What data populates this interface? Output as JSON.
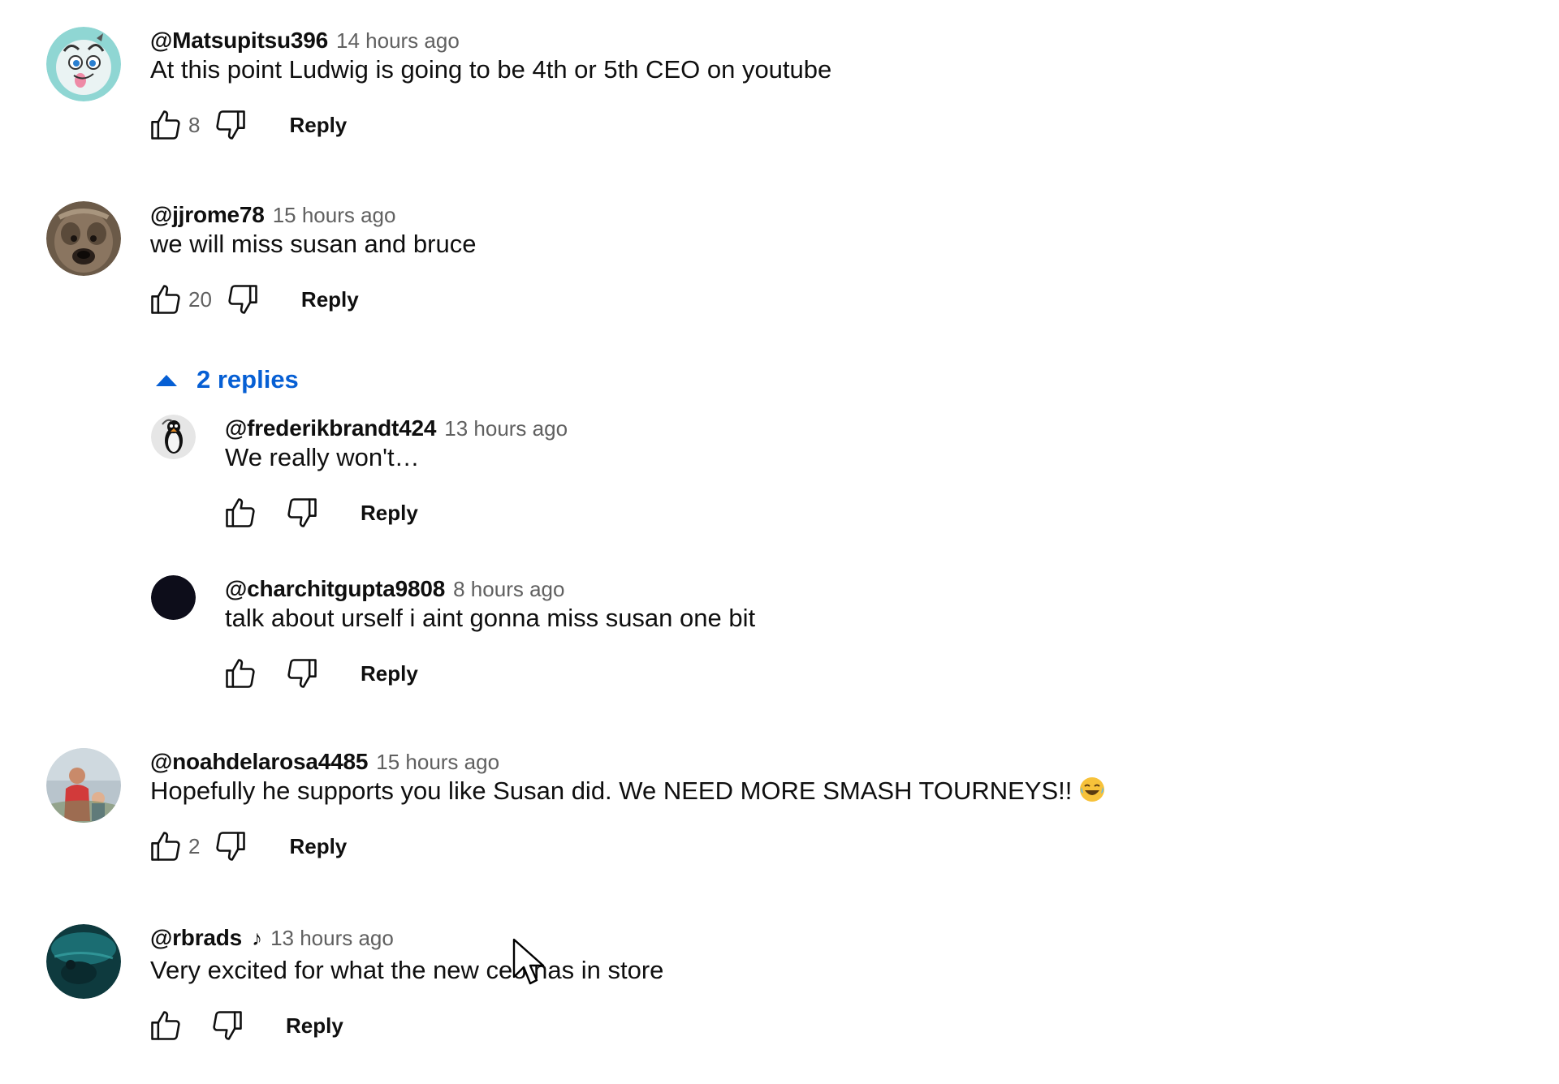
{
  "comments": [
    {
      "author": "@Matsupitsu396",
      "timestamp": "14 hours ago",
      "text": "At this point Ludwig is going to be 4th or 5th CEO on youtube",
      "likes": "8",
      "reply_label": "Reply"
    },
    {
      "author": "@jjrome78",
      "timestamp": "15 hours ago",
      "text": "we will miss susan and bruce",
      "likes": "20",
      "reply_label": "Reply",
      "replies_toggle": "2 replies",
      "replies": [
        {
          "author": "@frederikbrandt424",
          "timestamp": "13 hours ago",
          "text": "We really won't…",
          "likes": "",
          "reply_label": "Reply"
        },
        {
          "author": "@charchitgupta9808",
          "timestamp": "8 hours ago",
          "text": "talk about urself i aint gonna miss susan one bit",
          "likes": "",
          "reply_label": "Reply"
        }
      ]
    },
    {
      "author": "@noahdelarosa4485",
      "timestamp": "15 hours ago",
      "text": "Hopefully he supports you like Susan did. We NEED MORE SMASH TOURNEYS!!",
      "emoji": "face-with-tears-of-joy",
      "likes": "2",
      "reply_label": "Reply"
    },
    {
      "author": "@rbrads",
      "badge_icon": "music-note-icon",
      "timestamp": "13 hours ago",
      "text": "Very excited for what the new ceo has in store",
      "likes": "",
      "reply_label": "Reply"
    }
  ],
  "colors": {
    "text_primary": "#0f0f0f",
    "text_secondary": "#606060",
    "link_blue": "#065fd4",
    "background": "#ffffff"
  }
}
